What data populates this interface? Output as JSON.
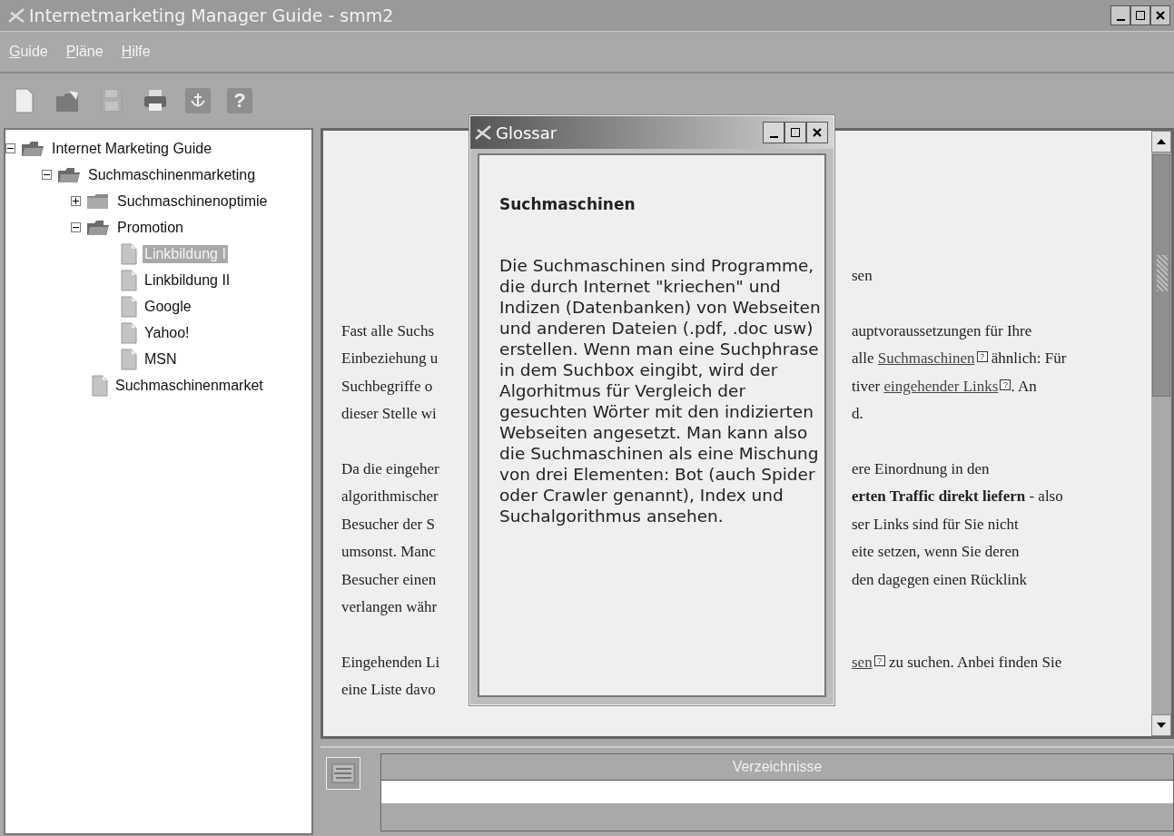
{
  "window": {
    "title": "Internetmarketing Manager Guide - smm2"
  },
  "menu": [
    "Guide",
    "Pläne",
    "Hilfe"
  ],
  "toolbar": [
    {
      "kind": "new"
    },
    {
      "kind": "open"
    },
    {
      "kind": "save",
      "disabled": true
    },
    {
      "kind": "print"
    },
    {
      "kind": "anchor"
    },
    {
      "kind": "help",
      "label": "?"
    }
  ],
  "tree": [
    {
      "label": "Internet Marketing Guide",
      "kind": "folder",
      "expanded": true,
      "selected": false,
      "children": [
        {
          "label": "Suchmaschinenmarketing",
          "kind": "folder",
          "expanded": true,
          "selected": false,
          "children": [
            {
              "label": "Suchmaschinenoptimie",
              "kind": "folder",
              "expanded": false,
              "selected": false
            },
            {
              "label": "Promotion",
              "kind": "folder",
              "expanded": true,
              "selected": false,
              "children": [
                {
                  "label": "Linkbildung I",
                  "kind": "page",
                  "selected": true
                },
                {
                  "label": "Linkbildung II",
                  "kind": "page",
                  "selected": false
                },
                {
                  "label": "Google",
                  "kind": "page",
                  "selected": false
                },
                {
                  "label": "Yahoo!",
                  "kind": "page",
                  "selected": false
                },
                {
                  "label": "MSN",
                  "kind": "page",
                  "selected": false
                }
              ]
            },
            {
              "label": "Suchmaschinenmarket",
              "kind": "page",
              "selected": false
            }
          ]
        }
      ]
    }
  ],
  "document": {
    "paragraphs": [
      {
        "lines": [
          {
            "right": [
              {
                "kind": "text",
                "text": "sen"
              }
            ]
          }
        ]
      },
      {
        "lines": [
          {
            "left": "Fast alle Suchs",
            "right": [
              {
                "kind": "text",
                "text": "auptvoraussetzungen für Ihre"
              }
            ]
          },
          {
            "left": "Einbeziehung u",
            "right": [
              {
                "kind": "text",
                "text": "alle "
              },
              {
                "kind": "link",
                "text": "Suchmaschinen",
                "icon": "?"
              },
              {
                "kind": "text",
                "text": " ähnlich: Für"
              }
            ]
          },
          {
            "left": "Suchbegriffe o",
            "right": [
              {
                "kind": "text",
                "text": "tiver "
              },
              {
                "kind": "link",
                "text": "eingehender Links",
                "icon": "?"
              },
              {
                "kind": "text",
                "text": ". An"
              }
            ]
          },
          {
            "left": "dieser Stelle wi",
            "right": [
              {
                "kind": "text",
                "text": "d."
              }
            ]
          }
        ]
      },
      {
        "lines": [
          {
            "left": "Da die eingeher",
            "right": [
              {
                "kind": "text",
                "text": "ere Einordnung in den"
              }
            ]
          },
          {
            "left": "algorithmischer",
            "right": [
              {
                "kind": "text",
                "text": "**erten Traffic direkt liefern** - also"
              }
            ]
          },
          {
            "left": "Besucher der S",
            "right": [
              {
                "kind": "text",
                "text": "ser Links sind für Sie nicht"
              }
            ]
          },
          {
            "left": "umsonst. Manc",
            "right": [
              {
                "kind": "text",
                "text": "eite setzen, wenn Sie deren"
              }
            ]
          },
          {
            "left": "Besucher einen",
            "right": [
              {
                "kind": "text",
                "text": "den dagegen einen Rücklink"
              }
            ]
          },
          {
            "left": "verlangen währ"
          }
        ]
      },
      {
        "lines": [
          {
            "left": "Eingehenden Li",
            "right": [
              {
                "kind": "link",
                "text": "sen",
                "icon": "?"
              },
              {
                "kind": "text",
                "text": " zu suchen. Anbei finden Sie"
              }
            ]
          },
          {
            "left": "eine Liste davo"
          }
        ]
      }
    ]
  },
  "glossary": {
    "title": "Glossar",
    "heading": "Suchmaschinen",
    "body": "Die Suchmaschinen sind Programme, die durch Internet \"kriechen\" und Indizen (Datenbanken) von Webseiten und anderen Dateien (.pdf, .doc usw) erstellen. Wenn man eine Suchphrase in dem Suchbox eingibt, wird der Algorhitmus für Vergleich der gesuchten Wörter mit den indizierten Webseiten angesetzt. Man kann also die Suchmaschinen als eine Mischung von drei Elementen: Bot (auch Spider oder Crawler genannt), Index und Suchalgorithmus ansehen."
  },
  "index_table": {
    "columns": [
      "Verzeichnisse"
    ]
  }
}
